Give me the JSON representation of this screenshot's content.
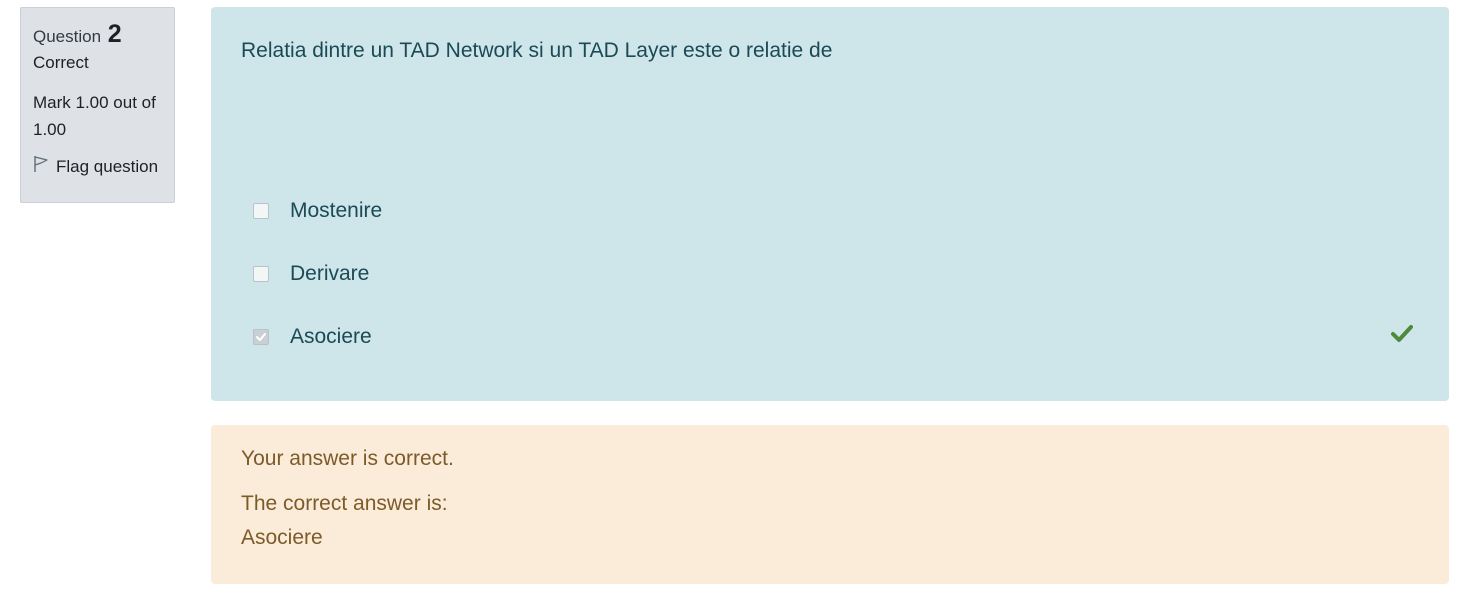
{
  "info": {
    "question_label": "Question",
    "question_number": "2",
    "state": "Correct",
    "grade": "Mark 1.00 out of 1.00",
    "flag_label": "Flag question"
  },
  "question": {
    "text": "Relatia dintre un TAD Network si un TAD Layer este o relatie de",
    "answers": [
      {
        "label": "Mostenire",
        "checked": false,
        "correct_mark": false
      },
      {
        "label": "Derivare",
        "checked": false,
        "correct_mark": false
      },
      {
        "label": "Asociere",
        "checked": true,
        "correct_mark": true
      }
    ]
  },
  "outcome": {
    "feedback": "Your answer is correct.",
    "right_answer_label": "The correct answer is:",
    "right_answer_value": "Asociere"
  },
  "colors": {
    "info_bg": "#dee2e6",
    "formulation_bg": "#cee5ea",
    "outcome_bg": "#fbecd9",
    "correct_tick": "#4d8a3a"
  },
  "icons": {
    "flag": "flag-icon",
    "correct": "checkmark-icon"
  }
}
